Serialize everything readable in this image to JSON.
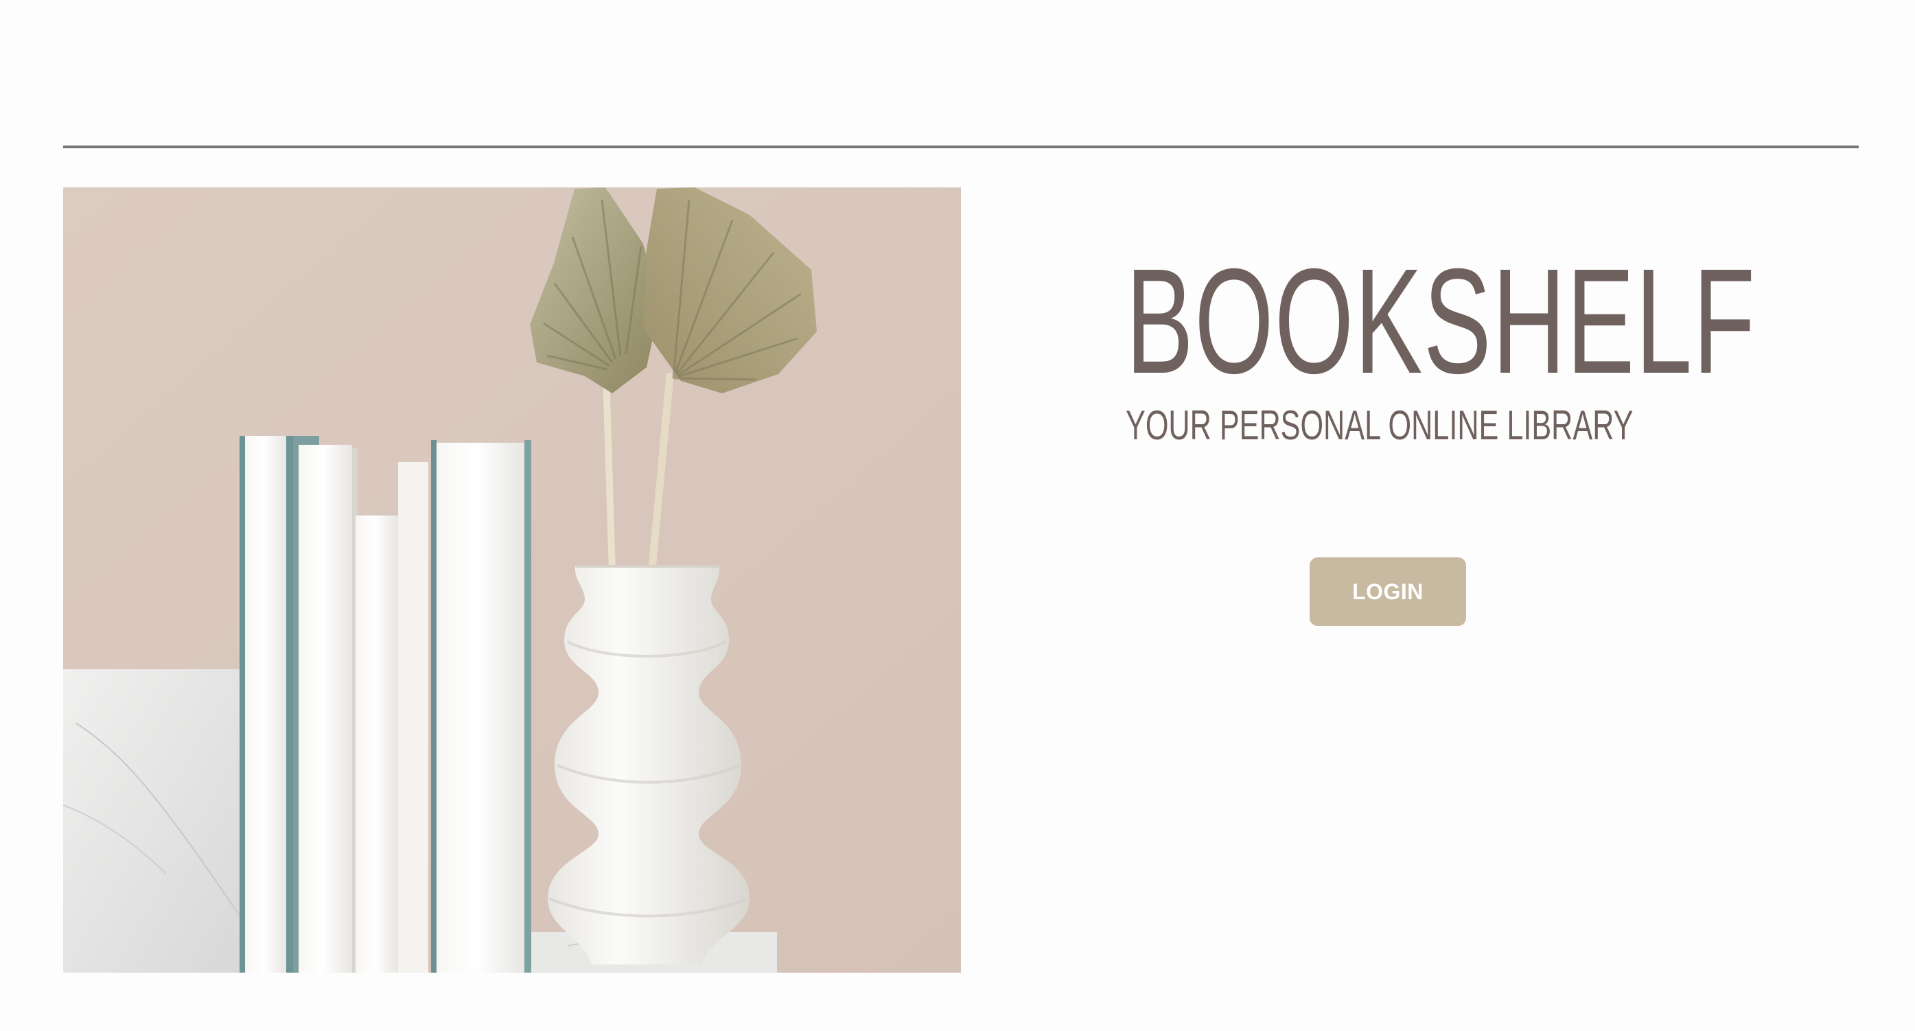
{
  "header": {
    "divider_color": "#7a7676"
  },
  "hero": {
    "image_type": "decorative product photo",
    "image_semantic": "books-vase-and-palm-leaves"
  },
  "brand": {
    "title": "BOOKSHELF",
    "subtitle": "YOUR PERSONAL ONLINE LIBRARY",
    "text_color": "#6f625e"
  },
  "actions": {
    "login_label": "LOGIN",
    "login_color": "#c8b9a1"
  },
  "colors": {
    "background": "#fefdfd",
    "photo_wall": "#dac8bd",
    "accent": "#c8b9a1"
  }
}
